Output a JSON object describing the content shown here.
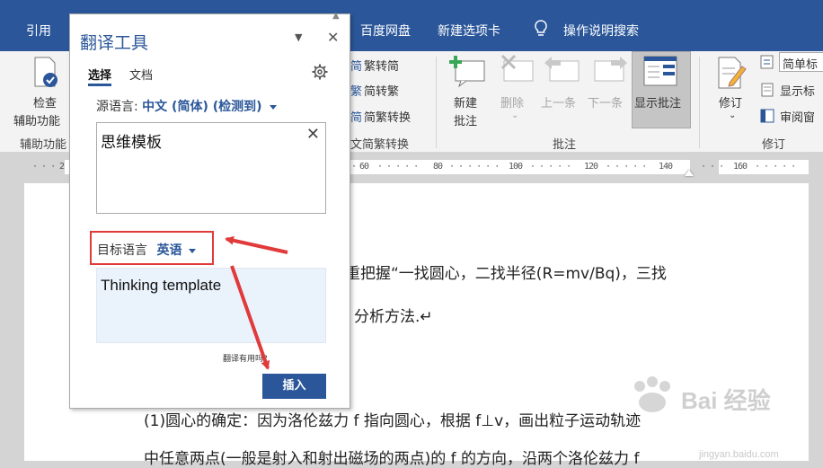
{
  "tabs": {
    "references": "引用",
    "baidu_pan": "百度网盘",
    "new_tab": "新建选项卡",
    "tell_me": "操作说明搜索"
  },
  "ribbon": {
    "check_accessibility": [
      "检查",
      "辅助功能"
    ],
    "accessibility_group": "辅助功能",
    "trad_to_simp": "繁转简",
    "simp_to_trad": "简转繁",
    "simp_trad_convert": "简繁转换",
    "chinese_convert_group": "文简繁转换",
    "new_comment": [
      "新建",
      "批注"
    ],
    "delete": "删除",
    "previous": "上一条",
    "next": "下一条",
    "show_comments": "显示批注",
    "comments_group": "批注",
    "track_changes": "修订",
    "simple_markup": "简单标",
    "show_markup": "显示标",
    "reviewing_pane": "审阅窗",
    "tracking_group": "修订"
  },
  "ruler": {
    "ticks": [
      "2",
      "60",
      "80",
      "100",
      "120",
      "140",
      "160"
    ]
  },
  "document": {
    "line1": "重把握“一找圆心，二找半径(R=mv/Bq)，三找",
    "line2": "分析方法.↵",
    "line3": "(1)圆心的确定：因为洛伦兹力 f 指向圆心，根据 f⊥v，画出粒子运动轨迹",
    "line4": "中任意两点(一般是射入和射出磁场的两点)的 f 的方向，沿两个洛伦兹力 f"
  },
  "translator": {
    "title": "翻译工具",
    "tab_selection": "选择",
    "tab_document": "文档",
    "source_label": "源语言:",
    "source_value": "中文 (简体) (检测到)",
    "source_text": "思维模板",
    "target_label": "目标语言",
    "target_value": "英语",
    "target_text": "Thinking template",
    "helpful": "翻译有用吗?",
    "insert": "插入"
  },
  "watermark": {
    "text": "Bai 经验",
    "sub": "jingyan.baidu.com"
  },
  "colors": {
    "ribbon_blue": "#2b579a",
    "annotation_red": "#e03a3a"
  }
}
